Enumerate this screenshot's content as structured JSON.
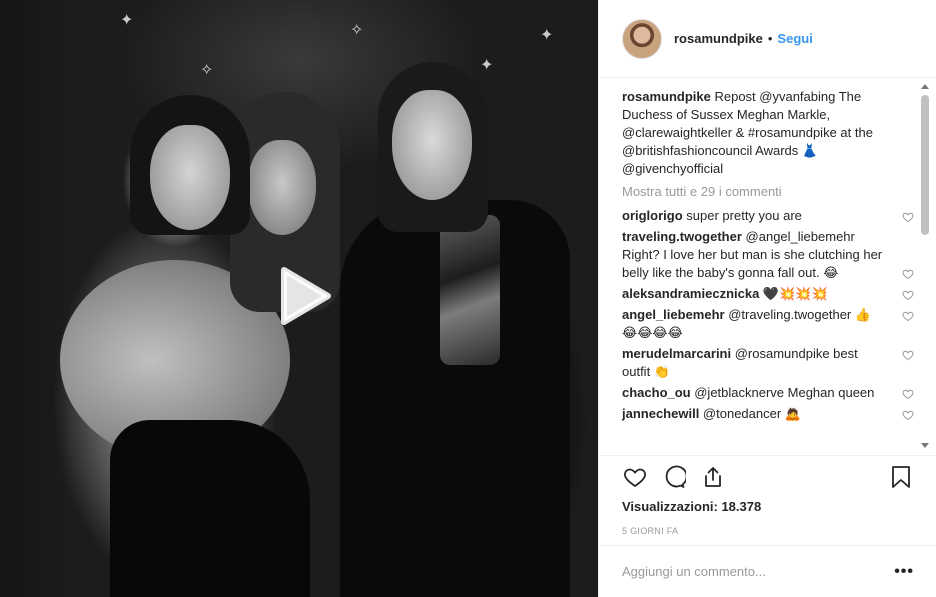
{
  "post": {
    "username": "rosamundpike",
    "follow_label": "Segui",
    "separator": "•"
  },
  "caption": {
    "username": "rosamundpike",
    "text": " Repost @yvanfabing The Duchess of Sussex Meghan Markle, @clarewaightkeller & #rosamundpike at the @britishfashioncouncil Awards 👗 @givenchyofficial"
  },
  "view_all_label": "Mostra tutti e 29 i commenti",
  "comments": [
    {
      "user": "origlorigo",
      "text": " super pretty you are"
    },
    {
      "user": "traveling.twogether",
      "text": " @angel_liebemehr Right? I love her but man is she clutching her belly like the baby's gonna fall out. 😂"
    },
    {
      "user": "aleksandramiecznicka",
      "text": " 🖤💥💥💥"
    },
    {
      "user": "angel_liebemehr",
      "text": " @traveling.twogether 👍😂😂😂😂"
    },
    {
      "user": "merudelmarcarini",
      "text": " @rosamundpike best outfit 👏"
    },
    {
      "user": "chacho_ou",
      "text": " @jetblacknerve Meghan queen"
    },
    {
      "user": "jannechewill",
      "text": " @tonedancer 🙇"
    }
  ],
  "stats": {
    "views_label": "Visualizzazioni:",
    "views_value": " 18.378",
    "age": "5 giorni fa"
  },
  "add_comment": {
    "placeholder": "Aggiungi un commento...",
    "more_label": "•••"
  },
  "icons": {
    "play": "play-icon",
    "like": "heart-icon",
    "comment": "comment-bubble-icon",
    "share": "share-icon",
    "save": "bookmark-icon",
    "more": "more-options-icon"
  },
  "colors": {
    "link_blue": "#3897f0",
    "text": "#262626",
    "muted": "#999999",
    "border": "#efefef"
  }
}
